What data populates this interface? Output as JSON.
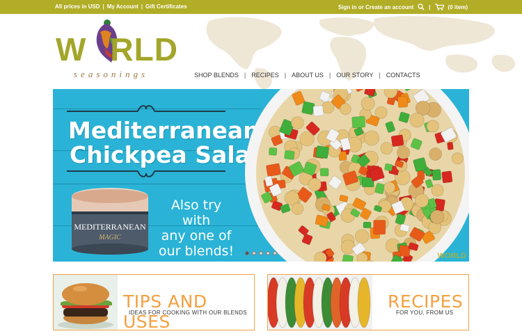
{
  "topbar": {
    "currency": "All prices in USD",
    "account": "My Account",
    "gift": "Gift Certificates",
    "signin": "Sign in or Create an account",
    "cart": "(0 item)",
    "search_icon": "search-icon",
    "cart_icon": "cart-icon"
  },
  "logo": {
    "word_w": "W",
    "word_rest": "RLD",
    "subtitle": "seasonings"
  },
  "nav": {
    "items": [
      "SHOP BLENDS",
      "RECIPES",
      "ABOUT US",
      "OUR STORY",
      "CONTACTS"
    ]
  },
  "hero": {
    "title_line1": "Mediterranean",
    "title_line2": "Chickpea Salad",
    "cta_line1": "Also try with",
    "cta_line2": "any one of",
    "cta_line3": "our blends!",
    "jar_line1": "MEDITERRANEAN",
    "jar_line2": "MAGIC",
    "watermark": "WORLD",
    "slides": 5,
    "active_slide": 1
  },
  "cards": {
    "tips_title": "TIPS AND USES",
    "tips_sub": "IDEAS FOR COOKING WITH OUR BLENDS",
    "recipes_title": "RECIPES",
    "recipes_sub": "FOR YOU, FROM US"
  },
  "colors": {
    "topbar": "#b1ad26",
    "hero_bg": "#2ab3d6",
    "accent_orange": "#f3a040",
    "logo_green": "#a3a62a"
  }
}
